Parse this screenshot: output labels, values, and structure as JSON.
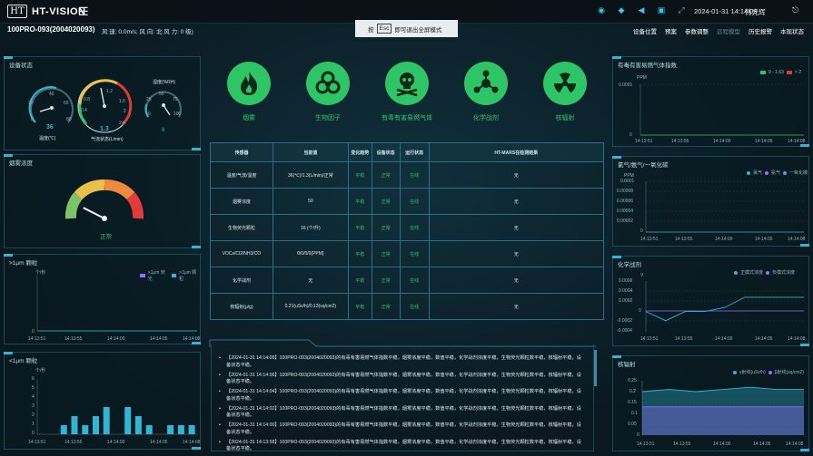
{
  "app": {
    "logo_mark": "HT",
    "name": "HT-VISION"
  },
  "topbar": {
    "datetime": "2024-01-31 14:14:08",
    "user": "韩光辉"
  },
  "device": {
    "id": "100PRO-093(2004020093)",
    "weather": "风 速: 0.0m/s; 风 向: 北 风 力: 0 级)"
  },
  "fullscreen_msg": {
    "before": "按",
    "key": "Esc",
    "after": "即可退出全屏模式"
  },
  "nav": [
    "设备位置",
    "预案",
    "参数调整",
    "远程模型",
    "历史报警",
    "本现状态"
  ],
  "device_status": {
    "title": "设备状态",
    "temp": {
      "label": "温度(℃)",
      "value": "36",
      "ticks": [
        "0",
        "20",
        "40",
        "60",
        "80"
      ]
    },
    "flow": {
      "label": "气流状态(L/min)",
      "value": "1.3",
      "ticks": [
        "0",
        "0.4",
        "0.8",
        "1.2",
        "1.6",
        "2",
        "2.4"
      ]
    },
    "humidity": {
      "label": "湿度(%RH)",
      "value": "8",
      "ticks": [
        "0",
        "25",
        "50",
        "75",
        "100"
      ]
    }
  },
  "smoke": {
    "title": "烟雾浓度",
    "status": "正常",
    "level": 0.15
  },
  "hazards": [
    {
      "label": "烟雾",
      "icon": "fire-icon"
    },
    {
      "label": "生物因子",
      "icon": "biohazard-icon"
    },
    {
      "label": "有毒有害易燃气体",
      "icon": "skull-icon"
    },
    {
      "label": "化学战剂",
      "icon": "chemical-icon"
    },
    {
      "label": "核辐射",
      "icon": "radiation-icon"
    }
  ],
  "table": {
    "headers": [
      "传感器",
      "当前值",
      "变化趋势",
      "设备状态",
      "运行状态",
      "HT-MARS在检测结果"
    ],
    "rows": [
      [
        "温度/气流/湿度",
        "36(℃)/1.3(L/min)/正常",
        "平稳",
        "正常",
        "在线",
        "无"
      ],
      [
        "烟雾浓度",
        "50",
        "平稳",
        "正常",
        "在线",
        "无"
      ],
      [
        "生物荧光颗粒",
        "16 (个/升)",
        "平稳",
        "正常",
        "在线",
        "无"
      ],
      [
        "VOCs/Cl2/NH3/CO",
        "0/0/0/0(PPM)",
        "平稳",
        "正常",
        "在线",
        "无"
      ],
      [
        "化学战剂",
        "无",
        "平稳",
        "正常",
        "在线",
        "无"
      ],
      [
        "核辐射(μ/g)",
        "0.21(uSv/h)/0.13(sq/cm2)",
        "平稳",
        "正常",
        "在线",
        "无"
      ]
    ]
  },
  "log": [
    "【2024-01-31 14:14:08】100PRO-093(2004020093)的有毒有害易燃气体指数平稳，烟雾浓度平稳，数值平稳，化学战剂浓度平稳，生物荧光颗粒数平稳，核辐射平稳，设备状态平稳。",
    "【2024-01-31 14:14:06】100PRO-093(2004020093)的有毒有害易燃气体指数平稳，烟雾浓度平稳，数值平稳，化学战剂浓度平稳，生物荧光颗粒数平稳，核辐射平稳，设备状态平稳。",
    "【2024-01-31 14:14:04】100PRO-093(2004020093)的有毒有害易燃气体指数平稳，烟雾浓度平稳，数值平稳，化学战剂浓度平稳，生物荧光颗粒数平稳，核辐射平稳，设备状态平稳。",
    "【2024-01-31 14:14:02】100PRO-093(2004020093)的有毒有害易燃气体指数平稳，烟雾浓度平稳，数值平稳，化学战剂浓度平稳，生物荧光颗粒数平稳，核辐射平稳，设备状态平稳。",
    "【2024-01-31 14:14:00】100PRO-093(2004020093)的有毒有害易燃气体指数平稳，烟雾浓度平稳，数值平稳，化学战剂浓度平稳，生物荧光颗粒数平稳，核辐射平稳，设备状态平稳。",
    "【2024-01-31 14:13:58】100PRO-093(2004020093)的有毒有害易燃气体指数平稳，烟雾浓度平稳，数值平稳，化学战剂浓度平稳，生物荧光颗粒数平稳，核辐射平稳，设备状态平稳。"
  ],
  "colors": {
    "accent": "#2fb6d4",
    "green": "#2ec567",
    "warn": "#e23b3b",
    "bg": "#0b1a24"
  },
  "chart_data": [
    {
      "type": "line",
      "title": ">1μm 颗粒",
      "ylabel": "个/秒",
      "x": [
        "14:13:51",
        "14:13:55",
        "14:14:00",
        "14:14:05",
        "14:14:08"
      ],
      "yticks": [
        "0"
      ],
      "series": [
        {
          "name": ">1μm 荧光",
          "color": "#9b6cff"
        },
        {
          "name": ">1μm 颗粒",
          "color": "#2fb6d4"
        }
      ],
      "values": [
        0,
        0,
        0,
        0,
        0
      ]
    },
    {
      "type": "bar",
      "title": "<1μm 颗粒",
      "ylabel": "个/秒",
      "x": [
        "14:13:51",
        "14:13:55",
        "14:14:00",
        "14:14:05",
        "14:14:08"
      ],
      "yticks": [
        "0",
        "1",
        "2",
        "3",
        "4",
        "5",
        "6"
      ],
      "ylim": [
        0,
        6
      ],
      "values": [
        0,
        0,
        1,
        2,
        1,
        2,
        3,
        0,
        3,
        2,
        1,
        0,
        1,
        1,
        1
      ]
    },
    {
      "type": "line",
      "title": "有毒有害易燃气体指数",
      "ylabel": "PPM",
      "x": [
        "14:13:51",
        "14:13:55",
        "14:14:00",
        "14:14:05",
        "14:14:08"
      ],
      "yticks": [
        "0",
        "0.0001"
      ],
      "legend": [
        "0 - 1.63",
        "> 2"
      ],
      "values": [
        0,
        0,
        0,
        0,
        0
      ]
    },
    {
      "type": "line",
      "title": "氯气/氨气/一氧化碳",
      "ylabel": "PPM",
      "x": [
        "14:13:51",
        "14:13:55",
        "14:14:00",
        "14:14:05",
        "14:14:08"
      ],
      "yticks": [
        "0",
        "0.00002",
        "0.00004",
        "0.00006",
        "0.00008",
        "0.0001"
      ],
      "series": [
        {
          "name": "氯气",
          "color": "#2fb6d4"
        },
        {
          "name": "氨气",
          "color": "#9b6cff"
        },
        {
          "name": "一氧化碳",
          "color": "#2fb6d4"
        }
      ],
      "values": [
        0,
        0,
        0,
        0,
        0
      ]
    },
    {
      "type": "line",
      "title": "化学战剂",
      "ylabel": "V",
      "x": [
        "14:13:51",
        "14:13:55",
        "14:14:00",
        "14:14:05",
        "14:14:08"
      ],
      "yticks": [
        "-0.0004",
        "-0.0002",
        "0",
        "0.0002",
        "0.0004",
        "0.0006"
      ],
      "ylim": [
        -0.0004,
        0.0006
      ],
      "series": [
        {
          "name": "正模式浓度",
          "color": "#2fb6d4"
        },
        {
          "name": "负模式浓度",
          "color": "#9b6cff"
        }
      ],
      "values": [
        0,
        -0.00018,
        0,
        0,
        8e-05,
        0.00028,
        0.00028,
        0.00028,
        0.00028
      ]
    },
    {
      "type": "area",
      "title": "核辐射",
      "x": [
        "14:13:51",
        "14:13:55",
        "14:14:00",
        "14:14:05",
        "14:14:08"
      ],
      "yticks": [
        "0",
        "0.05",
        "0.1",
        "0.15",
        "0.2",
        "0.25"
      ],
      "ylim": [
        0,
        0.25
      ],
      "series": [
        {
          "name": "γ射线(uSv/h)",
          "color": "#2fb6d4"
        },
        {
          "name": "β射线(sq/cm2)",
          "color": "#9b6cff"
        }
      ],
      "values_gamma": [
        0.2,
        0.21,
        0.2,
        0.21,
        0.22,
        0.21,
        0.21
      ],
      "values_beta": [
        0.13,
        0.13,
        0.13,
        0.13,
        0.13,
        0.13,
        0.13
      ]
    }
  ]
}
